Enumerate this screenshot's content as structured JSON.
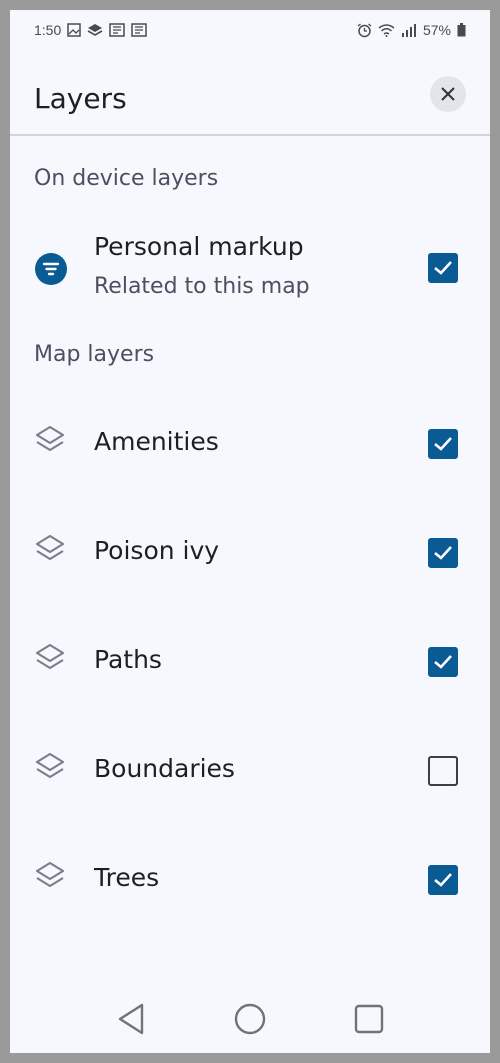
{
  "status_bar": {
    "time": "1:50",
    "battery": "57%"
  },
  "header": {
    "title": "Layers"
  },
  "sections": {
    "on_device": "On device layers",
    "map_layers": "Map layers"
  },
  "personal_markup": {
    "label": "Personal markup",
    "sublabel": "Related to this map",
    "checked": true
  },
  "layers": [
    {
      "label": "Amenities",
      "checked": true
    },
    {
      "label": "Poison ivy",
      "checked": true
    },
    {
      "label": "Paths",
      "checked": true
    },
    {
      "label": "Boundaries",
      "checked": false
    },
    {
      "label": "Trees",
      "checked": true
    }
  ],
  "colors": {
    "accent": "#0a5a94",
    "background": "#f7f8fd",
    "divider": "#d2d4da"
  }
}
